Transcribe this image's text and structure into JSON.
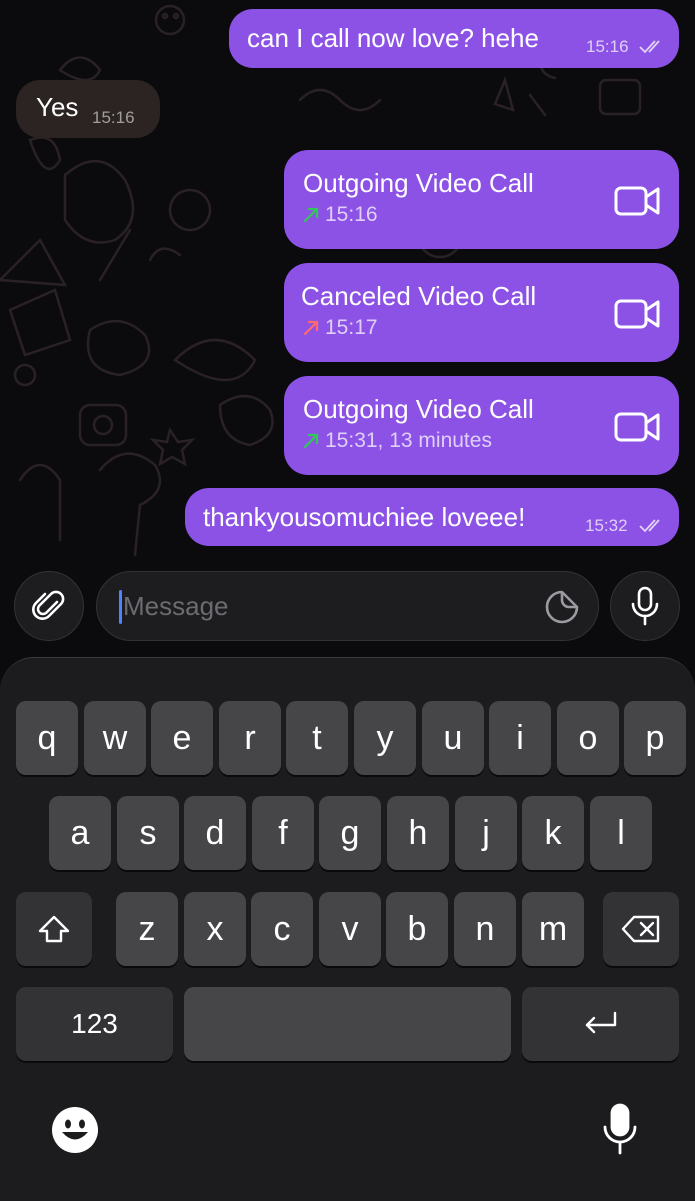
{
  "theme": {
    "outgoing_bubble": "#8c52e6",
    "incoming_bubble": "#2b2423",
    "missed_arrow": "#ff6b6b",
    "outgoing_arrow": "#34c759",
    "caret": "#4a86ff"
  },
  "messages": [
    {
      "kind": "text",
      "direction": "out",
      "text": "can I call now love? hehe",
      "time": "15:16",
      "status": "read"
    },
    {
      "kind": "text",
      "direction": "in",
      "text": "Yes",
      "time": "15:16"
    },
    {
      "kind": "call",
      "direction": "out",
      "title": "Outgoing Video Call",
      "meta": "15:16",
      "arrow": "outgoing",
      "icon": "video-camera-icon"
    },
    {
      "kind": "call",
      "direction": "out",
      "title": "Canceled Video Call",
      "meta": "15:17",
      "arrow": "canceled",
      "icon": "video-camera-icon"
    },
    {
      "kind": "call",
      "direction": "out",
      "title": "Outgoing Video Call",
      "meta": "15:31, 13 minutes",
      "arrow": "outgoing",
      "icon": "video-camera-icon"
    },
    {
      "kind": "text",
      "direction": "out",
      "text": "thankyousomuchiee loveee!",
      "time": "15:32",
      "status": "read"
    }
  ],
  "input_bar": {
    "attach_icon": "paperclip-icon",
    "placeholder": "Message",
    "sticker_icon": "sticker-icon",
    "mic_icon": "microphone-icon"
  },
  "keyboard": {
    "row1": [
      "q",
      "w",
      "e",
      "r",
      "t",
      "y",
      "u",
      "i",
      "o",
      "p"
    ],
    "row2": [
      "a",
      "s",
      "d",
      "f",
      "g",
      "h",
      "j",
      "k",
      "l"
    ],
    "row3": [
      "z",
      "x",
      "c",
      "v",
      "b",
      "n",
      "m"
    ],
    "shift_icon": "shift-icon",
    "delete_icon": "backspace-icon",
    "numbers_label": "123",
    "space_label": "",
    "return_icon": "return-icon",
    "emoji_icon": "emoji-icon",
    "dictation_icon": "microphone-icon"
  }
}
